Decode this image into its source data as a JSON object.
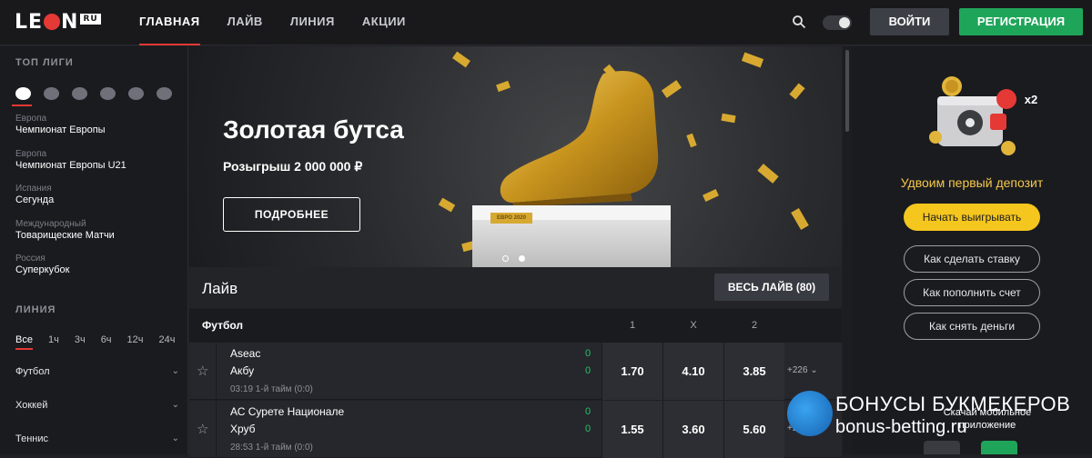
{
  "header": {
    "logo_text": "LEON",
    "logo_badge": "RU",
    "nav": [
      "ГЛАВНАЯ",
      "ЛАЙВ",
      "ЛИНИЯ",
      "АКЦИИ"
    ],
    "login_label": "ВОЙТИ",
    "register_label": "РЕГИСТРАЦИЯ"
  },
  "sidebar": {
    "top_leagues_title": "ТОП ЛИГИ",
    "sport_icons": [
      "soccer-icon",
      "hockey-icon",
      "tennis-icon",
      "basketball-icon",
      "esports-icon",
      "volleyball-icon"
    ],
    "leagues": [
      {
        "region": "Европа",
        "name": "Чемпионат Европы"
      },
      {
        "region": "Европа",
        "name": "Чемпионат Европы U21"
      },
      {
        "region": "Испания",
        "name": "Сегунда"
      },
      {
        "region": "Международный",
        "name": "Товарищеские Матчи"
      },
      {
        "region": "Россия",
        "name": "Суперкубок"
      }
    ],
    "line_title": "ЛИНИЯ",
    "periods": [
      "Все",
      "1ч",
      "3ч",
      "6ч",
      "12ч",
      "24ч"
    ],
    "sports": [
      "Футбол",
      "Хоккей",
      "Теннис"
    ]
  },
  "banner": {
    "title": "Золотая бутса",
    "subtitle": "Розыгрыш 2 000 000 ₽",
    "button": "ПОДРОБНЕЕ",
    "box_label": "ЕВРО 2020",
    "slides": 2,
    "active_slide": 2
  },
  "live": {
    "title": "Лайв",
    "all_button": "ВЕСЬ ЛАЙВ (80)",
    "sport": "Футбол",
    "columns": [
      "1",
      "X",
      "2"
    ],
    "matches": [
      {
        "team1": "Aseac",
        "team2": "Акбу",
        "score1": "0",
        "score2": "0",
        "time": "03:19 1-й тайм (0:0)",
        "odds": [
          "1.70",
          "4.10",
          "3.85"
        ],
        "more": "+226"
      },
      {
        "team1": "АС Сурете Национале",
        "team2": "Хруб",
        "score1": "0",
        "score2": "0",
        "time": "28:53 1-й тайм (0:0)",
        "odds": [
          "1.55",
          "3.60",
          "5.60"
        ],
        "more": "+225"
      }
    ]
  },
  "promo": {
    "multiplier": "x2",
    "headline": "Удвоим первый депозит",
    "cta": "Начать выигрывать",
    "links": [
      "Как сделать ставку",
      "Как пополнить счет",
      "Как снять деньги"
    ],
    "app_text": "Скачай мобильное приложение"
  },
  "watermark": {
    "line1": "БОНУСЫ БУКМЕКЕРОВ",
    "line2": "bonus-betting.ru"
  },
  "colors": {
    "accent": "#e53935",
    "register": "#1fa55a",
    "cta": "#f5c61d",
    "gold_text": "#f5c84b",
    "score": "#2bbf6a"
  }
}
